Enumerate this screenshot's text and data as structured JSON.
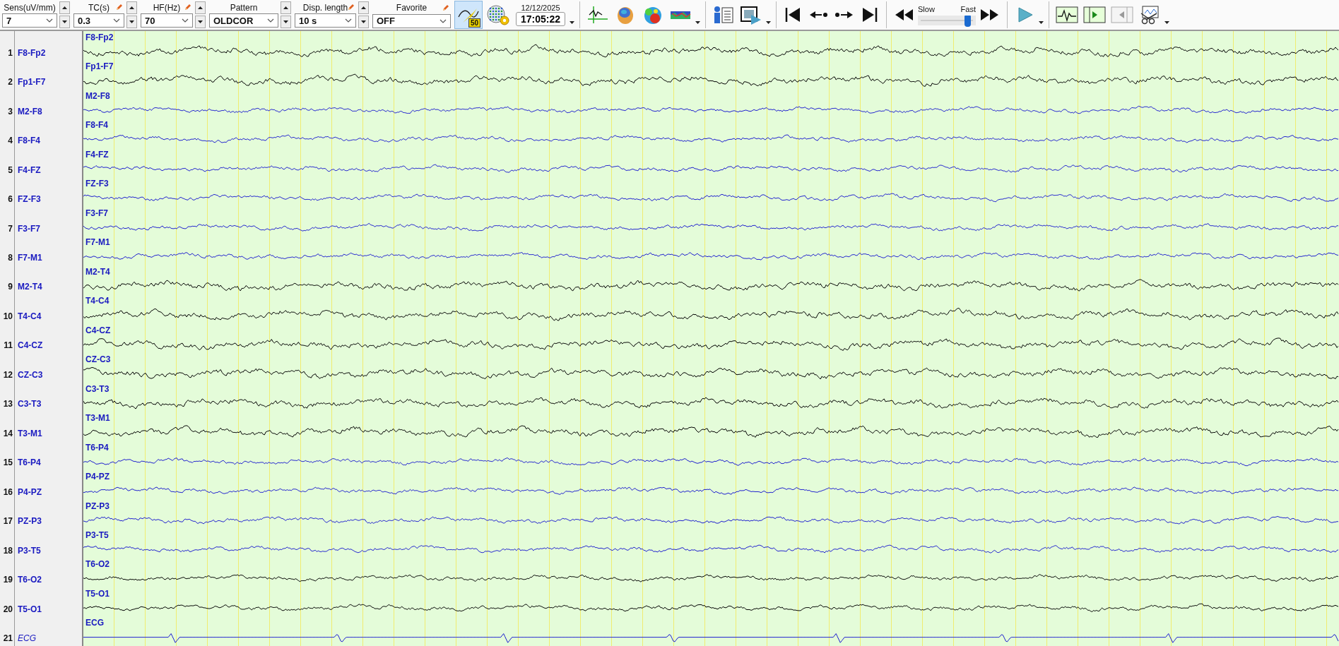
{
  "toolbar": {
    "settings": [
      {
        "label": "Sens(uV/mm)",
        "value": "7",
        "edit_icon": false,
        "spinner": true
      },
      {
        "label": "TC(s)",
        "value": "0.3",
        "edit_icon": true,
        "spinner": true
      },
      {
        "label": "HF(Hz)",
        "value": "70",
        "edit_icon": true,
        "spinner": true
      },
      {
        "label": "Pattern",
        "value": "OLDCOR",
        "edit_icon": false,
        "spinner": true
      },
      {
        "label": "Disp. length",
        "value": "10 s",
        "edit_icon": true,
        "spinner": true
      },
      {
        "label": "Favorite",
        "value": "OFF",
        "edit_icon": true,
        "spinner": false
      }
    ],
    "montage_button": {
      "badge": "50",
      "selected": true
    },
    "date": "12/12/2025",
    "time": "17:05:22",
    "speed": {
      "slow_label": "Slow",
      "fast_label": "Fast",
      "level": 0.92
    }
  },
  "channels": [
    {
      "number": "1",
      "name": "F8-Fp2",
      "trace_label": "F8-Fp2",
      "color": "#000000",
      "kind": "eeg"
    },
    {
      "number": "2",
      "name": "Fp1-F7",
      "trace_label": "Fp1-F7",
      "color": "#000000",
      "kind": "eeg"
    },
    {
      "number": "3",
      "name": "M2-F8",
      "trace_label": "M2-F8",
      "color": "#1c1cd0",
      "kind": "eeg"
    },
    {
      "number": "4",
      "name": "F8-F4",
      "trace_label": "F8-F4",
      "color": "#1c1cd0",
      "kind": "eeg"
    },
    {
      "number": "5",
      "name": "F4-FZ",
      "trace_label": "F4-FZ",
      "color": "#1c1cd0",
      "kind": "eeg"
    },
    {
      "number": "6",
      "name": "FZ-F3",
      "trace_label": "FZ-F3",
      "color": "#1c1cd0",
      "kind": "eeg"
    },
    {
      "number": "7",
      "name": "F3-F7",
      "trace_label": "F3-F7",
      "color": "#1c1cd0",
      "kind": "eeg"
    },
    {
      "number": "8",
      "name": "F7-M1",
      "trace_label": "F7-M1",
      "color": "#1c1cd0",
      "kind": "eeg"
    },
    {
      "number": "9",
      "name": "M2-T4",
      "trace_label": "M2-T4",
      "color": "#000000",
      "kind": "eeg"
    },
    {
      "number": "10",
      "name": "T4-C4",
      "trace_label": "T4-C4",
      "color": "#000000",
      "kind": "eeg"
    },
    {
      "number": "11",
      "name": "C4-CZ",
      "trace_label": "C4-CZ",
      "color": "#000000",
      "kind": "eeg"
    },
    {
      "number": "12",
      "name": "CZ-C3",
      "trace_label": "CZ-C3",
      "color": "#000000",
      "kind": "eeg"
    },
    {
      "number": "13",
      "name": "C3-T3",
      "trace_label": "C3-T3",
      "color": "#000000",
      "kind": "eeg"
    },
    {
      "number": "14",
      "name": "T3-M1",
      "trace_label": "T3-M1",
      "color": "#000000",
      "kind": "eeg"
    },
    {
      "number": "15",
      "name": "T6-P4",
      "trace_label": "T6-P4",
      "color": "#1c1cd0",
      "kind": "eeg"
    },
    {
      "number": "16",
      "name": "P4-PZ",
      "trace_label": "P4-PZ",
      "color": "#1c1cd0",
      "kind": "eeg"
    },
    {
      "number": "17",
      "name": "PZ-P3",
      "trace_label": "PZ-P3",
      "color": "#1c1cd0",
      "kind": "eeg"
    },
    {
      "number": "18",
      "name": "P3-T5",
      "trace_label": "P3-T5",
      "color": "#1c1cd0",
      "kind": "eeg"
    },
    {
      "number": "19",
      "name": "T6-O2",
      "trace_label": "T6-O2",
      "color": "#000000",
      "kind": "eeg"
    },
    {
      "number": "20",
      "name": "T5-O1",
      "trace_label": "T5-O1",
      "color": "#000000",
      "kind": "eeg"
    },
    {
      "number": "21",
      "name": "ECG",
      "trace_label": "ECG",
      "color": "#1c1cd0",
      "kind": "ecg"
    }
  ]
}
